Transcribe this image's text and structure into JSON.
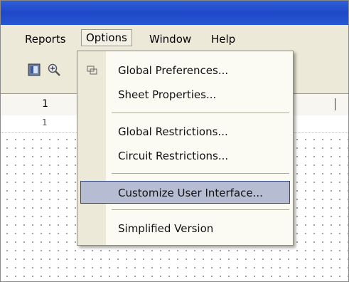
{
  "menubar": {
    "items": [
      {
        "label": "Reports"
      },
      {
        "label": "Options"
      },
      {
        "label": "Window"
      },
      {
        "label": "Help"
      }
    ]
  },
  "ruler": {
    "primary_number": "1",
    "secondary_number": "1"
  },
  "options_menu": {
    "items": [
      {
        "label": "Global Preferences..."
      },
      {
        "label": "Sheet Properties..."
      },
      {
        "label": "Global Restrictions..."
      },
      {
        "label": "Circuit Restrictions..."
      },
      {
        "label": "Customize User Interface..."
      },
      {
        "label": "Simplified Version"
      }
    ],
    "highlighted_item": "Customize User Interface..."
  },
  "colors": {
    "titlebar": "#1f48c8",
    "menubar": "#ece9d8",
    "highlight": "#b6bdd2"
  }
}
